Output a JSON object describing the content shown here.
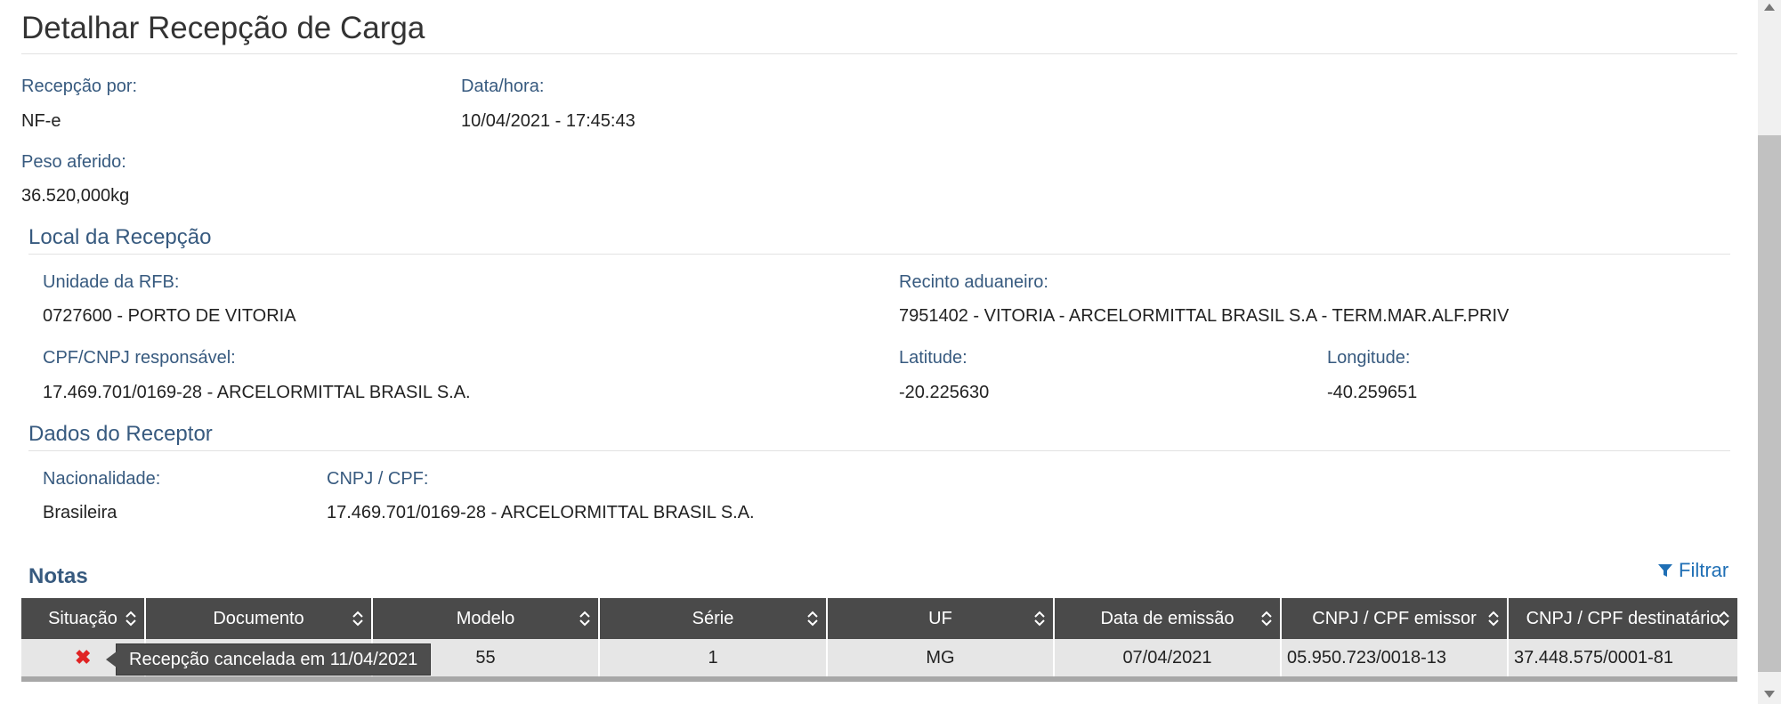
{
  "page": {
    "title": "Detalhar Recepção de Carga"
  },
  "summary": {
    "recepcao_por_label": "Recepção por:",
    "recepcao_por_value": "NF-e",
    "data_hora_label": "Data/hora:",
    "data_hora_value": "10/04/2021 - 17:45:43",
    "peso_label": "Peso aferido:",
    "peso_value": "36.520,000kg"
  },
  "local": {
    "title": "Local da Recepção",
    "unidade_label": "Unidade da RFB:",
    "unidade_value": "0727600 - PORTO DE VITORIA",
    "recinto_label": "Recinto aduaneiro:",
    "recinto_value": "7951402 - VITORIA - ARCELORMITTAL BRASIL S.A - TERM.MAR.ALF.PRIV",
    "cpf_label": "CPF/CNPJ responsável:",
    "cpf_value": "17.469.701/0169-28 - ARCELORMITTAL BRASIL S.A.",
    "latitude_label": "Latitude:",
    "latitude_value": "-20.225630",
    "longitude_label": "Longitude:",
    "longitude_value": "-40.259651"
  },
  "receptor": {
    "title": "Dados do Receptor",
    "nacionalidade_label": "Nacionalidade:",
    "nacionalidade_value": "Brasileira",
    "cnpj_label": "CNPJ / CPF:",
    "cnpj_value": "17.469.701/0169-28 - ARCELORMITTAL BRASIL S.A."
  },
  "notas": {
    "title": "Notas",
    "filter_label": "Filtrar",
    "columns": [
      "Situação",
      "Documento",
      "Modelo",
      "Série",
      "UF",
      "Data de emissão",
      "CNPJ / CPF emissor",
      "CNPJ / CPF destinatário"
    ],
    "row": {
      "situacao_icon": "red-x-icon",
      "tooltip": "Recepção cancelada em 11/04/2021",
      "modelo": "55",
      "serie": "1",
      "uf": "MG",
      "data_emissao": "07/04/2021",
      "emissor": "05.950.723/0018-13",
      "destinatario": "37.448.575/0001-81"
    }
  },
  "colors": {
    "header_bg": "#4a4a4a",
    "label": "#375a7f",
    "link": "#1f6fb5",
    "cancel": "#e02424"
  }
}
